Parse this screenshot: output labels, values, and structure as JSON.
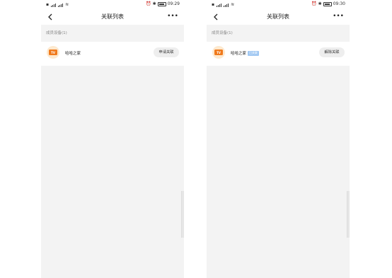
{
  "screens": [
    {
      "status": {
        "time": "09:29"
      },
      "nav": {
        "title": "关联列表",
        "more": "•••"
      },
      "section_header": "成员设备(1)",
      "device": {
        "icon_text": "TV",
        "name": "哈哈之家",
        "tag": "",
        "action_label": "申请关联"
      }
    },
    {
      "status": {
        "time": "09:30"
      },
      "nav": {
        "title": "关联列表",
        "more": "•••"
      },
      "section_header": "成员设备(1)",
      "device": {
        "icon_text": "TV",
        "name": "哈哈之家",
        "tag": "已关联",
        "action_label": "解除关联"
      }
    }
  ],
  "icons": {
    "back": "chevron-left-icon",
    "more": "more-horizontal-icon",
    "tv": "tv-icon"
  },
  "colors": {
    "accent_orange": "#f07a1c",
    "tv_bg": "#fde9cf",
    "tag_blue": "#9fc7f2",
    "pill_bg": "#eeeeee"
  }
}
